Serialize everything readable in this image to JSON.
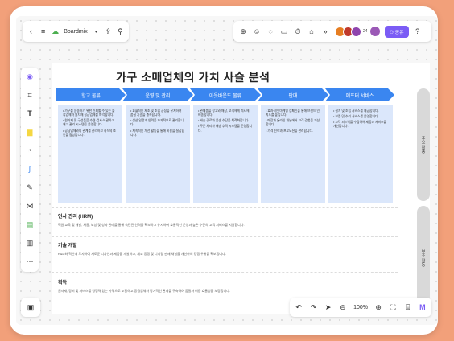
{
  "app": {
    "brand": "Boardmix"
  },
  "toolbar_right": {
    "avatar_count": "24",
    "share_label": "공유"
  },
  "board": {
    "title": "가구 소매업체의 가치 사슬 분석",
    "stages": [
      "항고 물류",
      "운영 및 관리",
      "아웃바운드 물류",
      "판매",
      "애프터 서비스"
    ],
    "stage_texts": [
      [
        "• 가구를 운송하기 위한 신뢰할 수 있는 물류업체와 원자재 공급업체를 파악합니다.",
        "• 원자재 및 구성품을 수령·검사·보관하고 재고 관리 시스템을 운영합니다.",
        "• 공급업체와의 관계를 관리하고 최적의 조건을 협상합니다."
      ],
      [
        "• 효율적인 제조 및 조립 공정을 유지하며 품질 기준을 충족합니다.",
        "• 생산 일정과 인력을 효과적으로 관리합니다.",
        "• 지속적인 개선 활동을 통해 비용을 절감합니다."
      ],
      [
        "• 완제품을 창고와 매장, 고객에게 적시에 배송합니다.",
        "• 배송 경로와 운송 수단을 최적화합니다.",
        "• 주문 처리와 배송 추적 시스템을 운영합니다."
      ],
      [
        "• 효과적인 마케팅 캠페인을 통해 브랜드 인지도를 높입니다.",
        "• 매장과 온라인 채널에서 고객 경험을 개선합니다.",
        "• 가격 전략과 프로모션을 관리합니다."
      ],
      [
        "• 설치 및 조립 서비스를 제공합니다.",
        "• 보증 및 수리 서비스를 운영합니다.",
        "• 고객 피드백을 수집하여 제품과 서비스를 개선합니다."
      ]
    ],
    "side_top": "주요 활동",
    "side_bottom": "보조 활동",
    "sections": [
      {
        "title": "인사 관리 (HRM)",
        "body": "직원 교육 및 개발, 채용, 보상 및 성과 관리를 통해 숙련된 인력을 확보하고 유지하여 효율적인 운영과 높은 수준의 고객 서비스를 지원합니다."
      },
      {
        "title": "기술 개발",
        "body": "R&D와 혁신에 투자하여 새로운 디자인과 제품을 개발하고, 제조 공정 및 디지털 판매 채널을 개선하여 경쟁 우위를 확보합니다."
      },
      {
        "title": "획득",
        "body": "원자재, 장비 및 서비스를 경쟁력 있는 가격으로 조달하고 공급업체와 장기적인 관계를 구축하여 품질과 비용 효율성을 보장합니다."
      }
    ]
  },
  "zoom": "100%",
  "colors": {
    "arrow": "#3a86f0",
    "column": "#dbe7fb",
    "accent": "#7b5cf5",
    "frame": "#f2a07a"
  }
}
